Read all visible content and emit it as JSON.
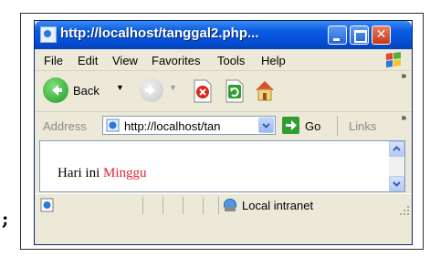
{
  "left_fragment": ";",
  "window": {
    "title": "http://localhost/tanggal2.php..."
  },
  "menu": {
    "items": [
      "File",
      "Edit",
      "View",
      "Favorites",
      "Tools",
      "Help"
    ]
  },
  "toolbar": {
    "back_label": "Back",
    "overflow": "»"
  },
  "address": {
    "label": "Address",
    "value": "http://localhost/tan",
    "go_label": "Go",
    "links_label": "Links",
    "links_overflow": "»"
  },
  "page": {
    "prefix": "Hari ini",
    "day": "Minggu"
  },
  "status": {
    "zone": "Local intranet"
  },
  "colors": {
    "title_bar": "#0550d8",
    "day_text": "#e3202f",
    "go_button": "#2f9e2f"
  }
}
